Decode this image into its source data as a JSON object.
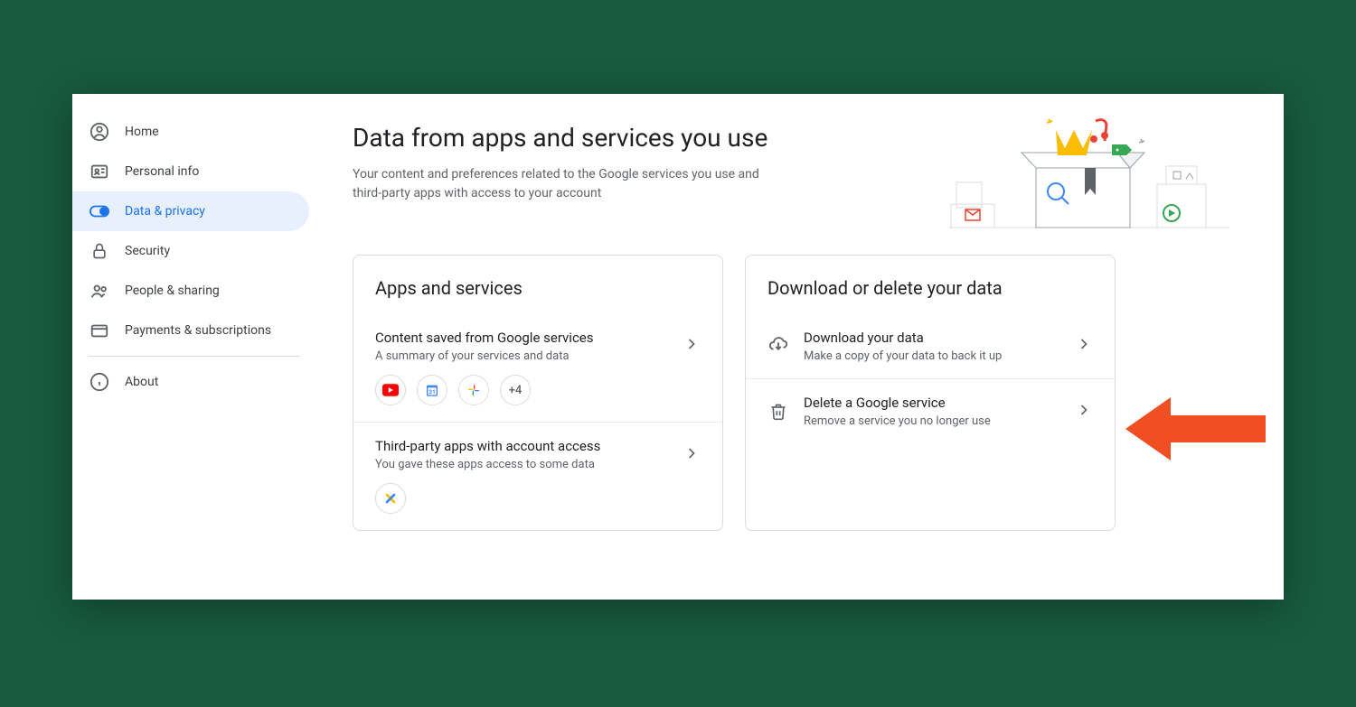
{
  "sidebar": {
    "items": [
      {
        "label": "Home",
        "icon": "user-circle"
      },
      {
        "label": "Personal info",
        "icon": "id-card"
      },
      {
        "label": "Data & privacy",
        "icon": "toggle",
        "active": true
      },
      {
        "label": "Security",
        "icon": "lock"
      },
      {
        "label": "People & sharing",
        "icon": "people"
      },
      {
        "label": "Payments & subscriptions",
        "icon": "card"
      }
    ],
    "about_label": "About"
  },
  "main": {
    "title": "Data from apps and services you use",
    "subtitle": "Your content and preferences related to the Google services you use and third-party apps with access to your account"
  },
  "card_apps": {
    "title": "Apps and services",
    "row1_title": "Content saved from Google services",
    "row1_sub": "A summary of your services and data",
    "chips_more": "+4",
    "row2_title": "Third-party apps with account access",
    "row2_sub": "You gave these apps access to some data"
  },
  "card_download": {
    "title": "Download or delete your data",
    "row1_title": "Download your data",
    "row1_sub": "Make a copy of your data to back it up",
    "row2_title": "Delete a Google service",
    "row2_sub": "Remove a service you no longer use"
  },
  "annotation": {
    "arrow_color": "#f04e23"
  }
}
